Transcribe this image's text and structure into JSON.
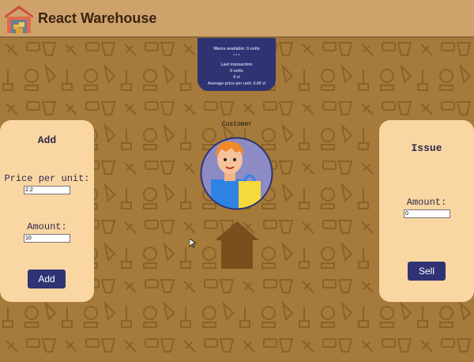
{
  "header": {
    "title": "React Warehouse",
    "logo_icon": "warehouse-icon"
  },
  "stats": {
    "wares_available": "Wares available: 0 units",
    "dots": "• • •",
    "last_transaction": "Last transaction",
    "units": "0 units",
    "zl": "0 zl",
    "average_price": "Average price per unit: 0.00 zl"
  },
  "add_panel": {
    "title": "Add",
    "price_label": "Price per unit:",
    "price_value": "2.2",
    "amount_label": "Amount:",
    "amount_value": "10",
    "button_label": "Add"
  },
  "issue_panel": {
    "title": "Issue",
    "amount_label": "Amount:",
    "amount_value": "0",
    "button_label": "Sell"
  },
  "customer": {
    "label": "Customer",
    "avatar_icon": "customer-avatar-icon"
  },
  "warehouse_icon": "house-icon",
  "colors": {
    "header_bg": "#cfa26c",
    "background": "#a57a3a",
    "panel_bg": "#fad6a2",
    "accent": "#2f3273"
  }
}
